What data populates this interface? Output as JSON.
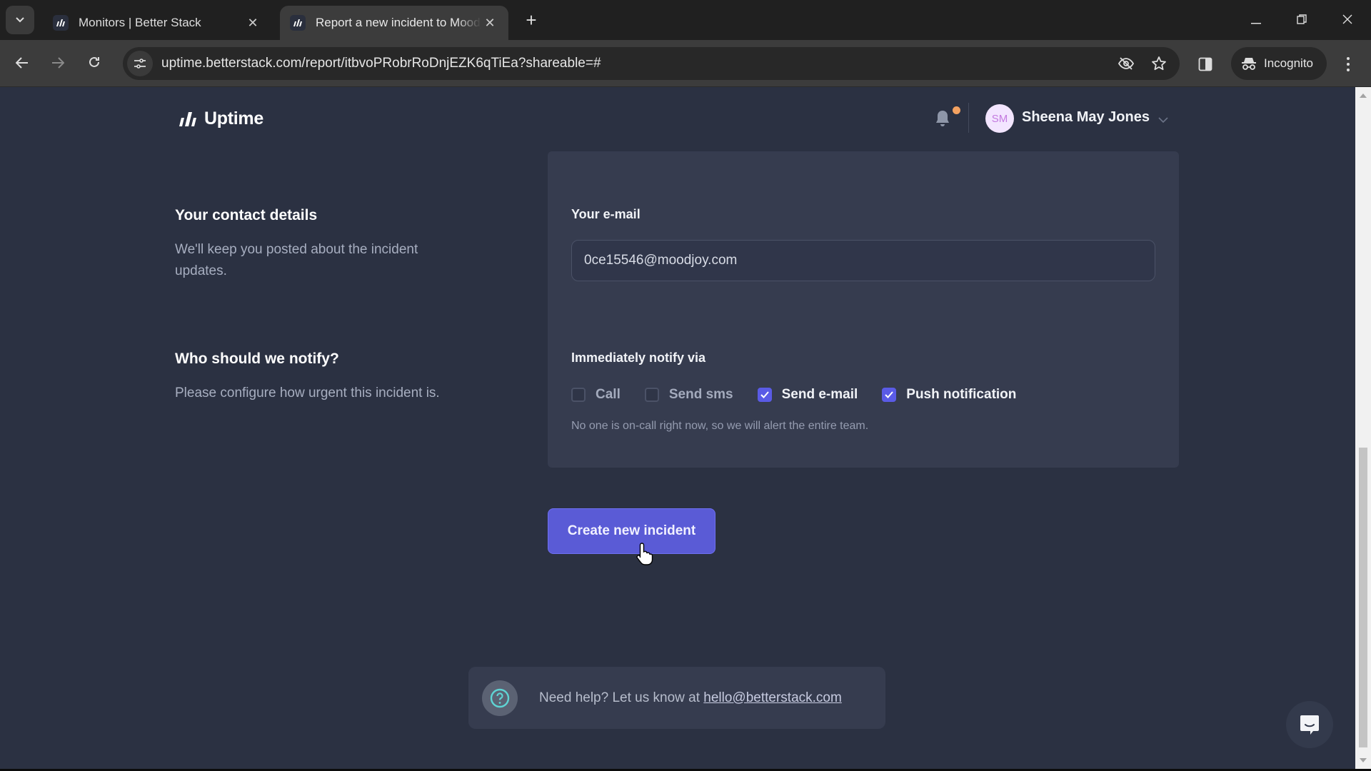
{
  "browser": {
    "tabs": [
      {
        "title": "Monitors | Better Stack",
        "active": false
      },
      {
        "title": "Report a new incident to Moodjoy",
        "active": true
      }
    ],
    "new_tab_label": "+",
    "url": "uptime.betterstack.com/report/itbvoPRobrRoDnjEZK6qTiEa?shareable=#",
    "incognito_label": "Incognito"
  },
  "header": {
    "logo_text": "Uptime",
    "user": {
      "initials": "SM",
      "name": "Sheena May Jones"
    },
    "notification_dot": true
  },
  "sections": {
    "contact": {
      "title": "Your contact details",
      "description": "We'll keep you posted about the incident updates."
    },
    "notify": {
      "title": "Who should we notify?",
      "description": "Please configure how urgent this incident is."
    }
  },
  "form": {
    "email_label": "Your e-mail",
    "email_value": "0ce15546@moodjoy.com",
    "notify_label": "Immediately notify via",
    "channels": [
      {
        "label": "Call",
        "checked": false
      },
      {
        "label": "Send sms",
        "checked": false
      },
      {
        "label": "Send e-mail",
        "checked": true
      },
      {
        "label": "Push notification",
        "checked": true
      }
    ],
    "notify_hint": "No one is on-call right now, so we will alert the entire team.",
    "submit_label": "Create new incident"
  },
  "help": {
    "text": "Need help? Let us know at",
    "email": "hello@betterstack.com"
  },
  "colors": {
    "accent": "#5a5bd6",
    "page_bg": "#2b3142",
    "card_bg": "#363c4f",
    "notification_dot": "#f4a261"
  }
}
